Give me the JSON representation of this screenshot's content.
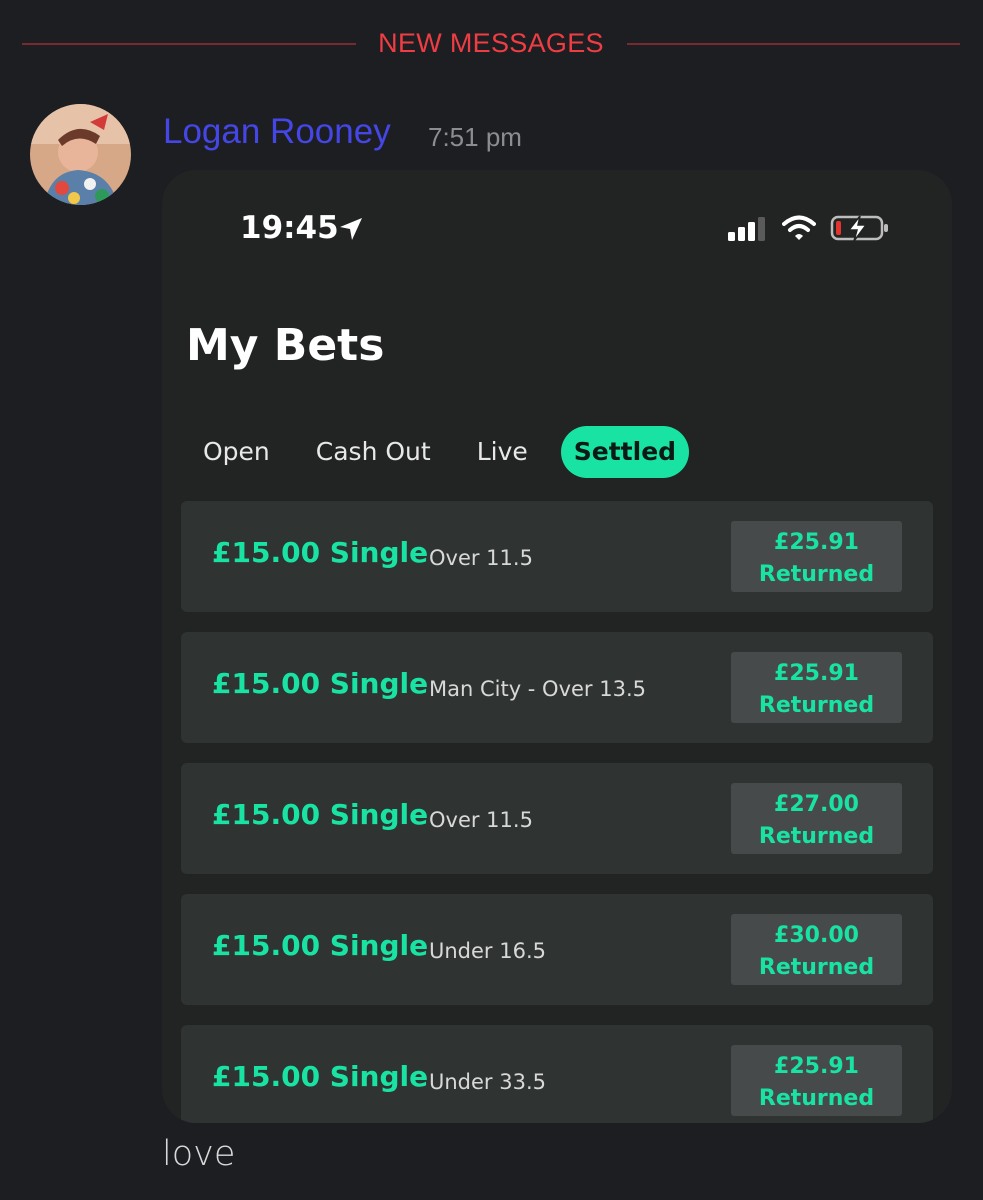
{
  "divider": {
    "label": "NEW MESSAGES",
    "color": "#ee3d43"
  },
  "message": {
    "author": "Logan Rooney",
    "author_color": "#4446e6",
    "timestamp": "7:51 pm",
    "text": "love"
  },
  "screenshot": {
    "status_time": "19:45",
    "icons": [
      "location-arrow-icon",
      "signal-icon",
      "wifi-icon",
      "battery-charging-icon"
    ],
    "title": "My Bets",
    "tabs": [
      {
        "label": "Open",
        "active": false
      },
      {
        "label": "Cash Out",
        "active": false
      },
      {
        "label": "Live",
        "active": false
      },
      {
        "label": "Settled",
        "active": true
      }
    ],
    "accent": "#19e3a3",
    "bets": [
      {
        "amount": "£15.00 Single",
        "desc": "Over 11.5",
        "returned_value": "£25.91",
        "returned_label": "Returned"
      },
      {
        "amount": "£15.00 Single",
        "desc": "Man City - Over 13.5",
        "returned_value": "£25.91",
        "returned_label": "Returned"
      },
      {
        "amount": "£15.00 Single",
        "desc": "Over 11.5",
        "returned_value": "£27.00",
        "returned_label": "Returned"
      },
      {
        "amount": "£15.00 Single",
        "desc": "Under 16.5",
        "returned_value": "£30.00",
        "returned_label": "Returned"
      },
      {
        "amount": "£15.00 Single",
        "desc": "Under 33.5",
        "returned_value": "£25.91",
        "returned_label": "Returned"
      }
    ]
  }
}
